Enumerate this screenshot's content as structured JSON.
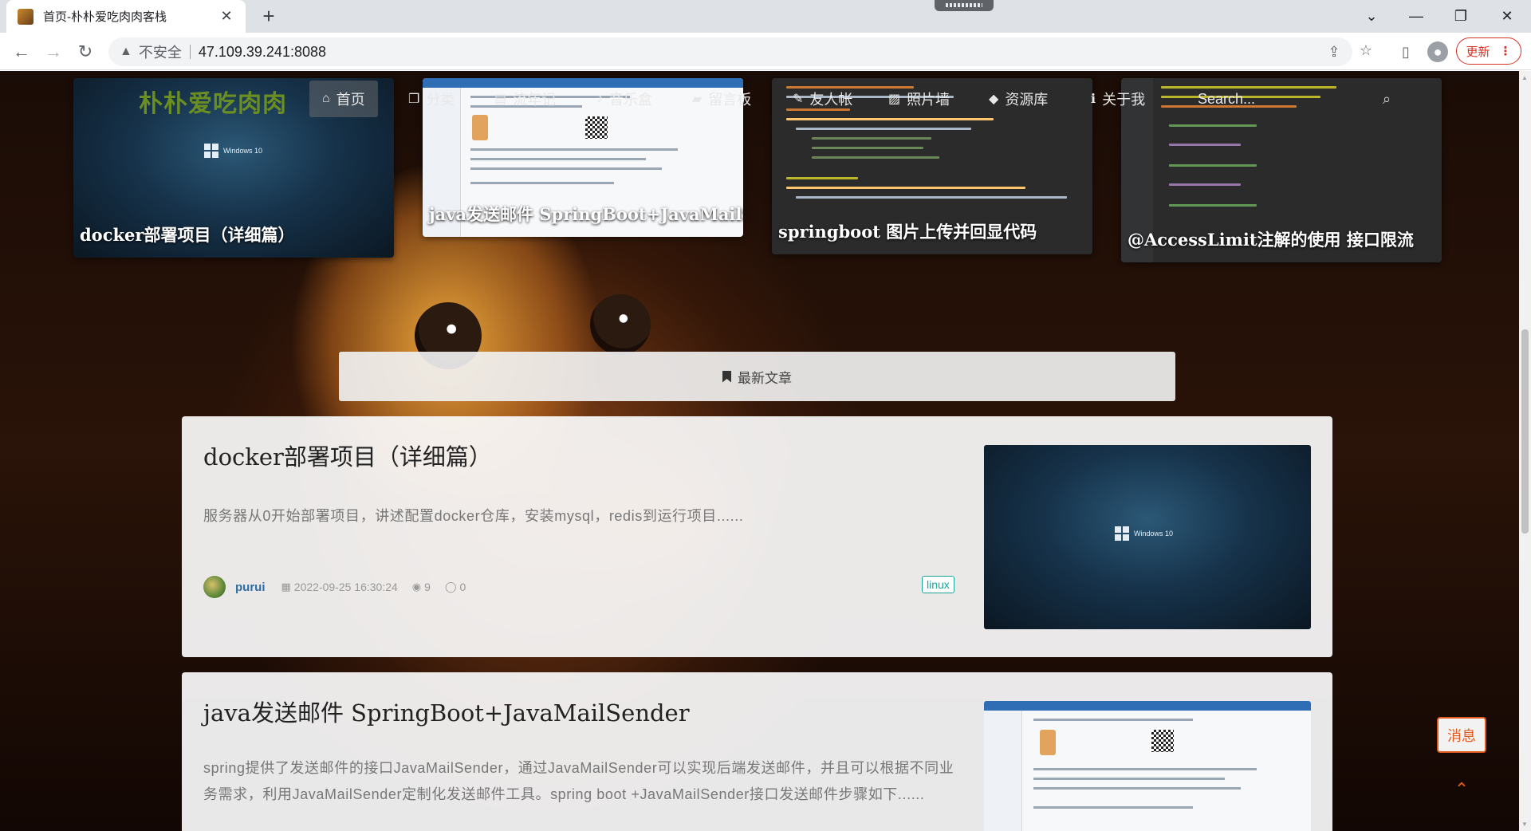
{
  "browser": {
    "tab_title": "首页-朴朴爱吃肉肉客栈",
    "tab_close": "✕",
    "new_tab": "+",
    "insecure_label": "不安全",
    "url": "47.109.39.241:8088",
    "update_label": "更新",
    "menu_dots": "⋮"
  },
  "nav": {
    "brand": "朴朴爱吃肉肉",
    "items": [
      {
        "label": "首页",
        "icon": "home-icon"
      },
      {
        "label": "分类",
        "icon": "copy-icon"
      },
      {
        "label": "流年记",
        "icon": "book-icon"
      },
      {
        "label": "音乐盒",
        "icon": "music-icon"
      },
      {
        "label": "留言板",
        "icon": "bookmark-icon"
      },
      {
        "label": "友人帐",
        "icon": "pencil-icon"
      },
      {
        "label": "照片墙",
        "icon": "picture-icon"
      },
      {
        "label": "资源库",
        "icon": "graduation-cap-icon"
      },
      {
        "label": "关于我",
        "icon": "info-icon"
      }
    ],
    "search_placeholder": "Search..."
  },
  "featured": [
    {
      "title": "docker部署项目（详细篇）",
      "thumb_text": "Windows 10"
    },
    {
      "title": "java发送邮件 SpringBoot+JavaMailSender"
    },
    {
      "title": "springboot 图片上传并回显代码"
    },
    {
      "title": "@AccessLimit注解的使用 接口限流"
    }
  ],
  "section": {
    "label": "最新文章"
  },
  "articles": [
    {
      "title": "docker部署项目（详细篇）",
      "excerpt": "服务器从0开始部署项目，讲述配置docker仓库，安装mysql，redis到运行项目......",
      "author": "purui",
      "date": "2022-09-25 16:30:24",
      "views": "9",
      "comments": "0",
      "tag": "linux",
      "thumb_text": "Windows 10"
    },
    {
      "title": "java发送邮件 SpringBoot+JavaMailSender",
      "excerpt": "spring提供了发送邮件的接口JavaMailSender，通过JavaMailSender可以实现后端发送邮件，并且可以根据不同业务需求，利用JavaMailSender定制化发送邮件工具。spring boot +JavaMailSender接口发送邮件步骤如下......"
    }
  ],
  "floating": {
    "message_label": "消息",
    "to_top": "⌃"
  },
  "colors": {
    "brand": "#6b8e23",
    "accent": "#e05a1c",
    "tag": "#1ba39c",
    "author": "#2e6da4"
  }
}
